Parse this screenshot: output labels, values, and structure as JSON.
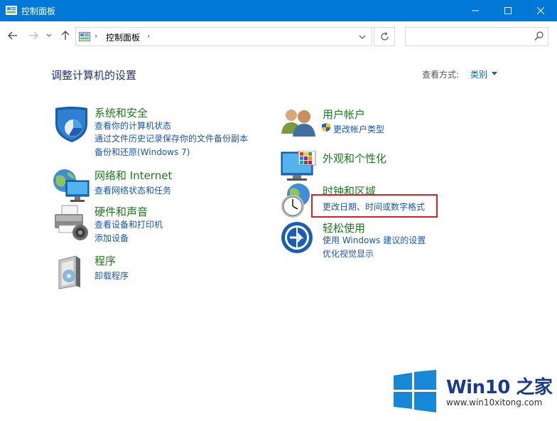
{
  "window": {
    "title": "控制面板"
  },
  "address": {
    "crumb": "控制面板",
    "search_placeholder": ""
  },
  "main": {
    "heading": "调整计算机的设置",
    "view_by_label": "查看方式:",
    "view_by_value": "类别"
  },
  "categories_left": [
    {
      "title": "系统和安全",
      "links": [
        "查看你的计算机状态",
        "通过文件历史记录保存你的文件备份副本",
        "备份和还原(Windows 7)"
      ]
    },
    {
      "title": "网络和 Internet",
      "links": [
        "查看网络状态和任务"
      ]
    },
    {
      "title": "硬件和声音",
      "links": [
        "查看设备和打印机",
        "添加设备"
      ]
    },
    {
      "title": "程序",
      "links": [
        "卸载程序"
      ]
    }
  ],
  "categories_right": [
    {
      "title": "用户帐户",
      "links": [
        "更改帐户类型"
      ]
    },
    {
      "title": "外观和个性化",
      "links": []
    },
    {
      "title": "时钟和区域",
      "links": [
        "更改日期、时间或数字格式"
      ]
    },
    {
      "title": "轻松使用",
      "links": [
        "使用 Windows 建议的设置",
        "优化视觉显示"
      ]
    }
  ],
  "watermark": {
    "brand": "Win10 之家",
    "url": "www.win10xitong.com"
  },
  "colors": {
    "titlebar": "#0078d7",
    "category_title": "#1c7a1c",
    "link": "#1a56b4",
    "heading": "#1e3287",
    "highlight_box": "#e02020"
  }
}
